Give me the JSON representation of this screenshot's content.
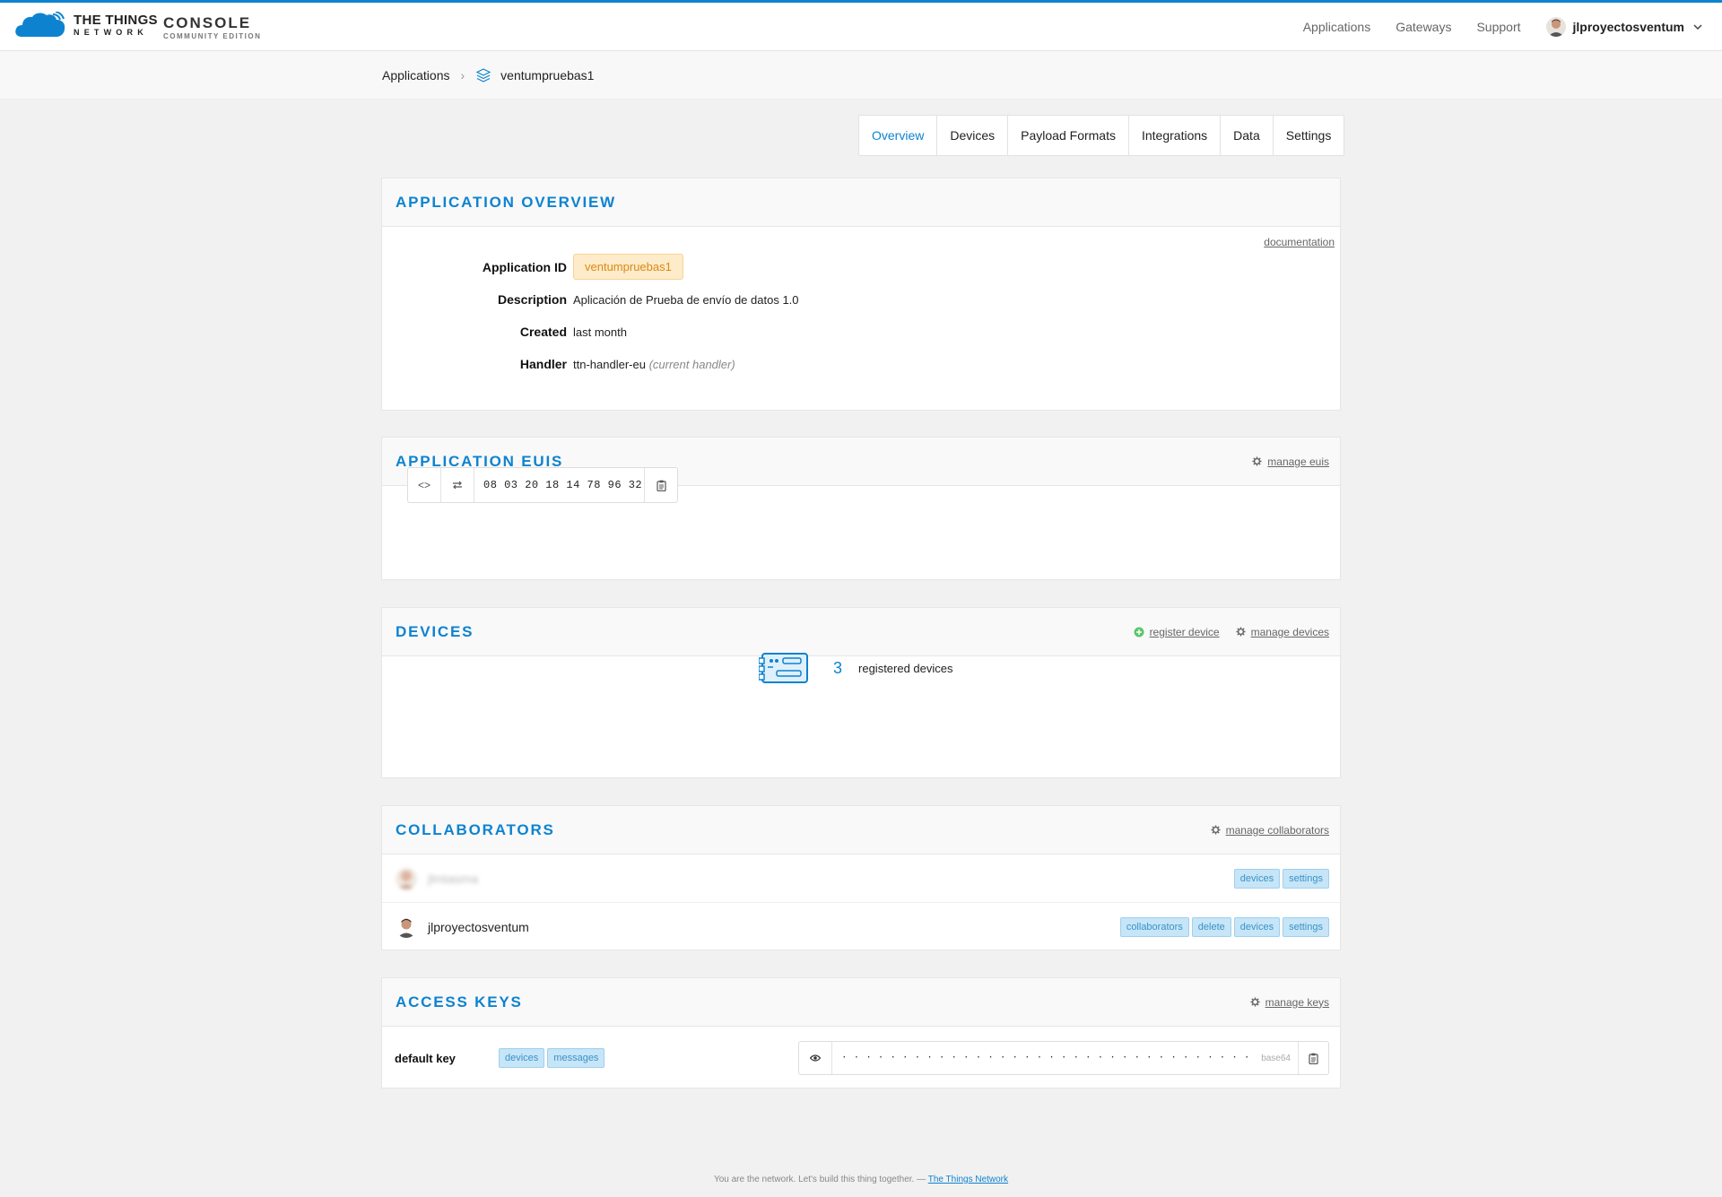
{
  "brand": {
    "line1": "THE THINGS",
    "line2": "NETWORK",
    "console_title": "CONSOLE",
    "console_edition": "COMMUNITY EDITION"
  },
  "nav": {
    "applications": "Applications",
    "gateways": "Gateways",
    "support": "Support",
    "username": "jlproyectosventum"
  },
  "breadcrumb": {
    "root": "Applications",
    "current": "ventumpruebas1"
  },
  "tabs": [
    "Overview",
    "Devices",
    "Payload Formats",
    "Integrations",
    "Data",
    "Settings"
  ],
  "active_tab": "Overview",
  "overview": {
    "title": "APPLICATION OVERVIEW",
    "documentation_link": "documentation",
    "fields": {
      "app_id_label": "Application ID",
      "app_id_value": "ventumpruebas1",
      "description_label": "Description",
      "description_value": "Aplicación de Prueba de envío de datos 1.0",
      "created_label": "Created",
      "created_value": "last month",
      "handler_label": "Handler",
      "handler_value": "ttn-handler-eu",
      "handler_note": "(current handler)"
    }
  },
  "euis": {
    "title": "APPLICATION EUIS",
    "manage_link": "manage euis",
    "toggle_format": "<>",
    "value": "08 03 20 18 14 78 96 32"
  },
  "devices": {
    "title": "DEVICES",
    "register_link": "register device",
    "manage_link": "manage devices",
    "count": "3",
    "count_label": "registered devices"
  },
  "collaborators": {
    "title": "COLLABORATORS",
    "manage_link": "manage collaborators",
    "rows": [
      {
        "name": "jlmtasma",
        "blurred": true,
        "rights": [
          "devices",
          "settings"
        ]
      },
      {
        "name": "jlproyectosventum",
        "blurred": false,
        "rights": [
          "collaborators",
          "delete",
          "devices",
          "settings"
        ]
      }
    ]
  },
  "access_keys": {
    "title": "ACCESS KEYS",
    "manage_link": "manage keys",
    "key_name": "default key",
    "key_rights": [
      "devices",
      "messages"
    ],
    "key_masked": "· · · · · · · · · · · · · · · · · · · · · · · · · · · · · · · · · · · · · · · · · · · · · · · · · · · · · · · · · · · · · · · ·",
    "key_format": "base64"
  },
  "footer": {
    "text": "You are the network. Let's build this thing together. —",
    "link": "The Things Network"
  },
  "colors": {
    "accent": "#0d83d0",
    "badge_bg": "#fdebc9",
    "tag_bg": "#c6e5f7",
    "register_icon": "#5cc66a"
  }
}
